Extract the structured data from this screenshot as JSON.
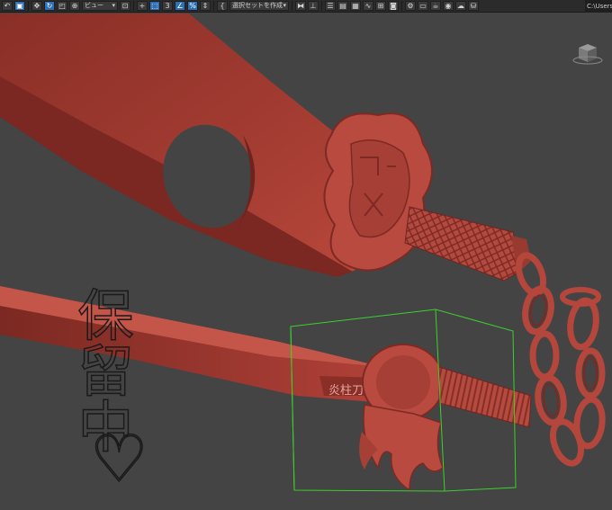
{
  "toolbar": {
    "view_dropdown": "ビュー",
    "selection_set_dropdown": "選択セットを作成",
    "snap_number": "3",
    "percent_snap": "%",
    "path_field": "C:\\Users\\"
  },
  "viewport": {
    "background_color": "#444444",
    "model_color": "#b5443a",
    "selection_box_color": "#3ad12e",
    "overlay_text": "保留中",
    "overlay_heart": "♡",
    "tsuba_engraving": "炎柱刀"
  },
  "icons": [
    "select-icon",
    "move-icon",
    "rotate-icon",
    "scale-icon",
    "link-icon",
    "snap-icon",
    "angle-snap-icon",
    "percent-snap-icon",
    "mirror-icon",
    "align-icon",
    "layer-icon",
    "curve-editor-icon",
    "schematic-icon",
    "material-editor-icon",
    "render-setup-icon",
    "render-frame-icon",
    "render-icon",
    "viewcube-icon"
  ]
}
